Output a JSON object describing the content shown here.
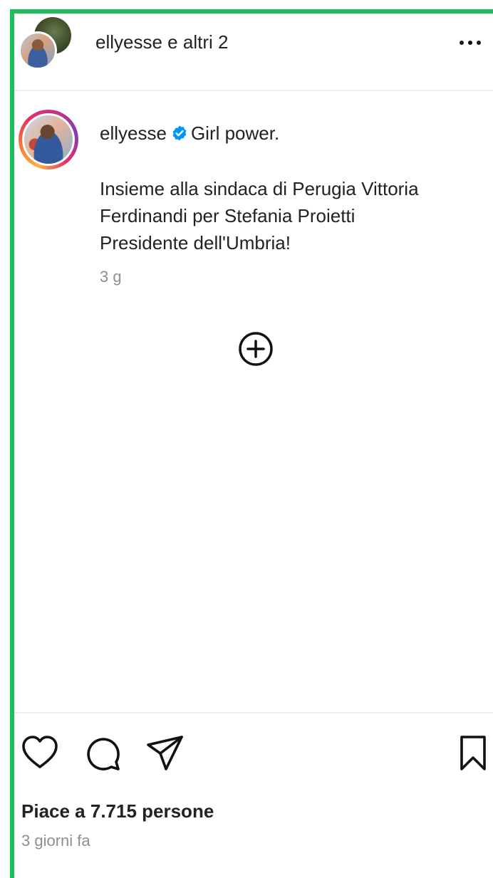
{
  "header": {
    "username": "ellyesse",
    "connector": " e ",
    "others": "altri 2",
    "more_icon": "more-horizontal-icon"
  },
  "post": {
    "username": "ellyesse",
    "verified": true,
    "caption_first": "Girl power.",
    "caption_lines": [
      "Insieme alla sindaca di Perugia Vittoria",
      "Ferdinandi per Stefania Proietti",
      "Presidente dell'Umbria!"
    ],
    "time_short": "3 g",
    "add_icon": "add-circle-icon"
  },
  "actions": {
    "like_icon": "heart-icon",
    "comment_icon": "comment-icon",
    "share_icon": "send-icon",
    "save_icon": "bookmark-icon"
  },
  "likes_text": "Piace a 7.715 persone",
  "time_long": "3 giorni fa",
  "colors": {
    "frame": "#1dbf5b",
    "verified": "#0095f6",
    "muted": "#8e8e8e"
  }
}
